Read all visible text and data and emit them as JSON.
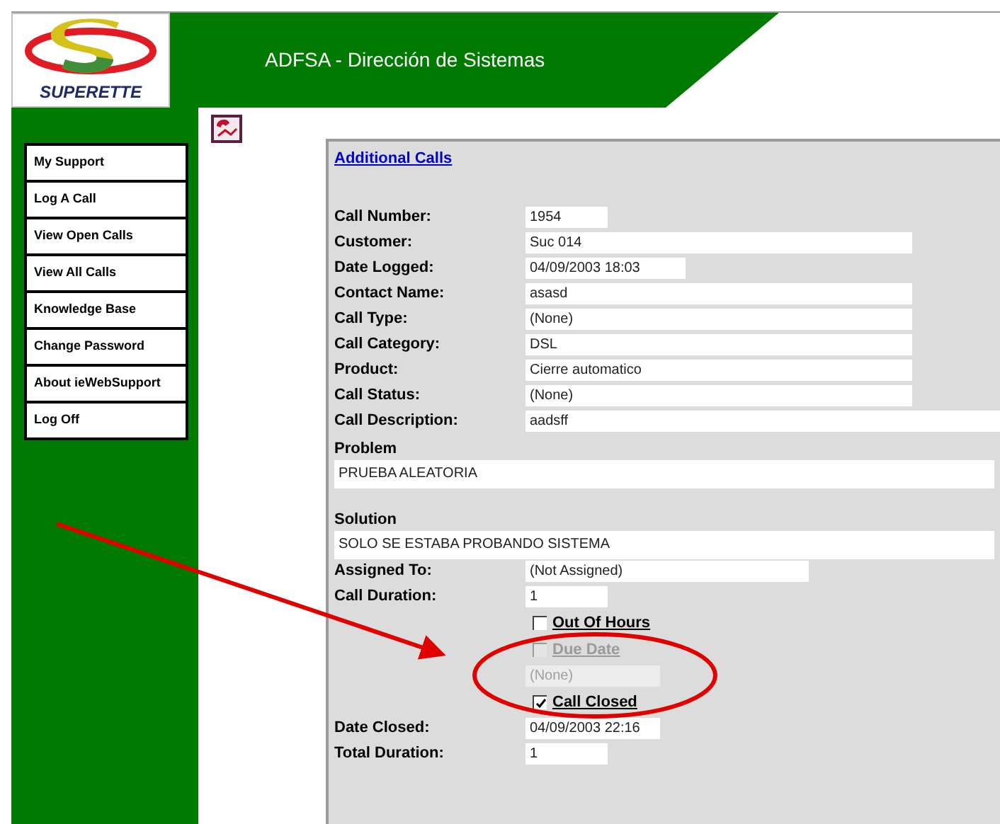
{
  "header": {
    "logo_text": "SUPERETTE",
    "title": "ADFSA - Dirección de Sistemas"
  },
  "sidebar": {
    "items": [
      {
        "label": "My Support"
      },
      {
        "label": "Log A Call"
      },
      {
        "label": "View Open Calls"
      },
      {
        "label": "View All Calls"
      },
      {
        "label": "Knowledge Base"
      },
      {
        "label": "Change Password"
      },
      {
        "label": "About ieWebSupport"
      },
      {
        "label": "Log Off"
      }
    ]
  },
  "panel": {
    "link": "Additional Calls",
    "items": [
      {
        "kind": "field",
        "label": "Call Number:",
        "value": "1954"
      },
      {
        "kind": "field",
        "label": "Customer:",
        "value": "Suc 014"
      },
      {
        "kind": "field",
        "label": "Date Logged:",
        "value": "04/09/2003 18:03"
      },
      {
        "kind": "field",
        "label": "Contact Name:",
        "value": "asasd"
      },
      {
        "kind": "field",
        "label": "Call Type:",
        "value": "(None)"
      },
      {
        "kind": "field",
        "label": "Call Category:",
        "value": "DSL"
      },
      {
        "kind": "field",
        "label": "Product:",
        "value": "Cierre automatico"
      },
      {
        "kind": "field",
        "label": "Call Status:",
        "value": "(None)"
      },
      {
        "kind": "field",
        "label": "Call Description:",
        "value": "aadsff"
      },
      {
        "kind": "block",
        "label": "Problem",
        "value": "PRUEBA ALEATORIA"
      },
      {
        "kind": "block",
        "label": "Solution",
        "value": "SOLO SE ESTABA PROBANDO SISTEMA"
      },
      {
        "kind": "field",
        "label": "Assigned To:",
        "value": "(Not Assigned)"
      },
      {
        "kind": "field",
        "label": "Call Duration:",
        "value": "1"
      },
      {
        "kind": "checkbox",
        "label": "Out Of Hours",
        "checked": false,
        "disabled": false
      },
      {
        "kind": "checkbox",
        "label": "Due Date",
        "checked": false,
        "disabled": true
      },
      {
        "kind": "field",
        "value": "(None)",
        "disabled": true
      },
      {
        "kind": "checkbox",
        "label": "Call Closed",
        "checked": true,
        "disabled": false
      },
      {
        "kind": "field",
        "label": "Date Closed:",
        "value": "04/09/2003 22:16"
      },
      {
        "kind": "field",
        "label": "Total Duration:",
        "value": "1"
      }
    ]
  }
}
